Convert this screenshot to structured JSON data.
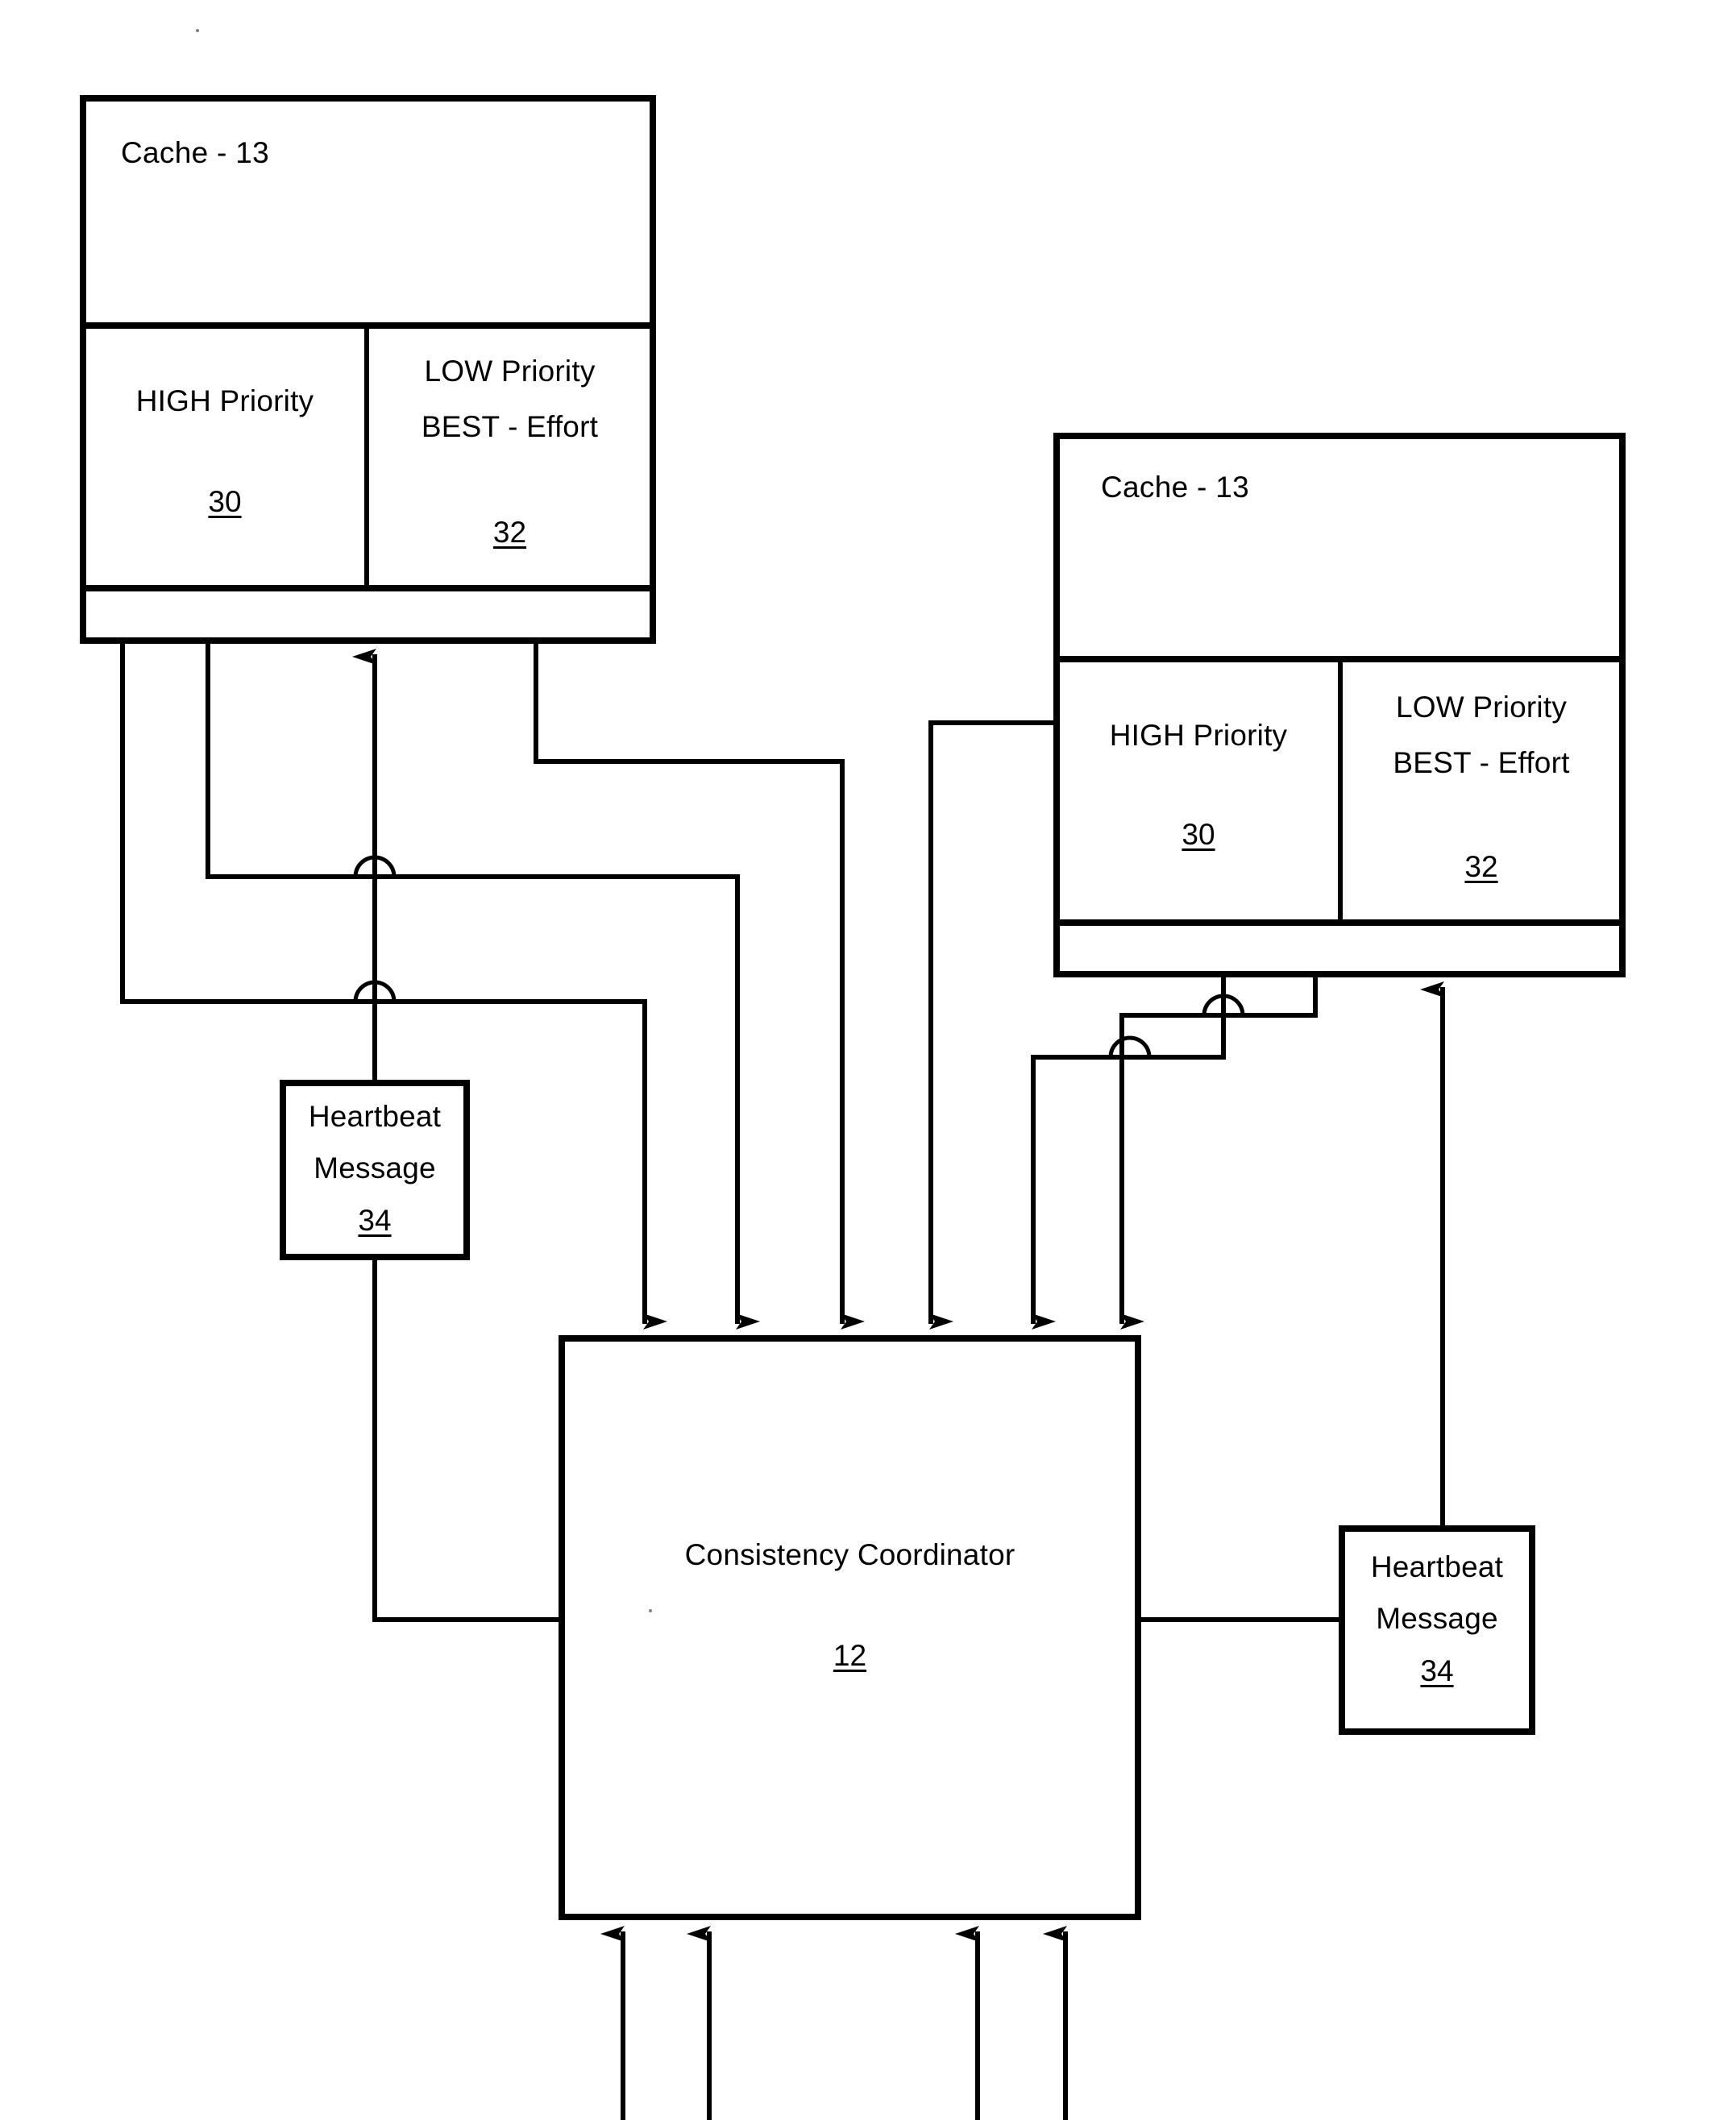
{
  "figure": {
    "kind": "patent-block-diagram",
    "background_color": "#ffffff",
    "line_color": "#000000"
  },
  "cache_left": {
    "title": "Cache - 13",
    "high_priority_label": "HIGH Priority",
    "high_priority_ref": "30",
    "low_priority_label_line1": "LOW Priority",
    "low_priority_label_line2": "BEST - Effort",
    "low_priority_ref": "32"
  },
  "cache_right": {
    "title": "Cache - 13",
    "high_priority_label": "HIGH Priority",
    "high_priority_ref": "30",
    "low_priority_label_line1": "LOW Priority",
    "low_priority_label_line2": "BEST - Effort",
    "low_priority_ref": "32"
  },
  "heartbeat_left": {
    "line1": "Heartbeat",
    "line2": "Message",
    "ref": "34"
  },
  "heartbeat_right": {
    "line1": "Heartbeat",
    "line2": "Message",
    "ref": "34"
  },
  "coordinator": {
    "title": "Consistency Coordinator",
    "ref": "12"
  }
}
